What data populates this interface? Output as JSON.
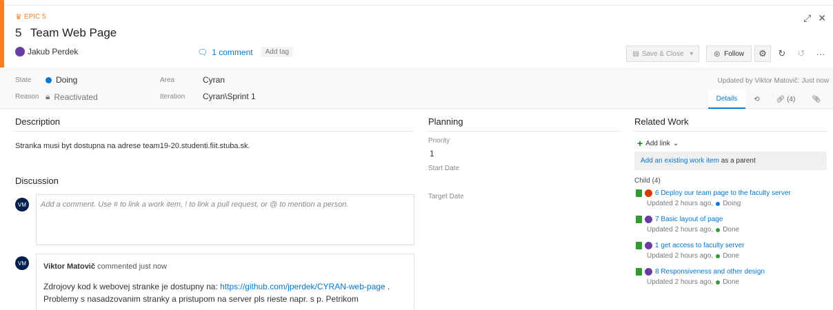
{
  "header": {
    "type_label": "EPIC 5",
    "id": "5",
    "title": "Team Web Page",
    "assignee": "Jakub Perdek",
    "comments": "1 comment",
    "add_tag": "Add tag",
    "save_label": "Save & Close",
    "follow_label": "Follow",
    "icons": [
      "crown-icon",
      "expand-icon",
      "close-icon",
      "save-icon",
      "eye-icon",
      "gear-icon",
      "refresh-icon",
      "undo-icon",
      "more-icon"
    ]
  },
  "fields": {
    "state_label": "State",
    "state_value": "Doing",
    "reason_label": "Reason",
    "reason_value": "Reactivated",
    "area_label": "Area",
    "area_value": "Cyran",
    "iteration_label": "Iteration",
    "iteration_value": "Cyran\\Sprint 1",
    "updated_by": "Updated by Viktor Matovič: Just now"
  },
  "tabs": {
    "details": "Details",
    "links": "(4)"
  },
  "description": {
    "title": "Description",
    "text": "Stranka musi byt dostupna na adrese team19-20.studenti.fiit.stuba.sk."
  },
  "discussion": {
    "title": "Discussion",
    "avatar_initials": "VM",
    "placeholder": "Add a comment. Use # to link a work item, ! to link a pull request, or @ to mention a person.",
    "comment": {
      "author": "Viktor Matovič",
      "meta": "commented just now",
      "text_prefix": "Zdrojovy kod k webovej stranke je dostupny na: ",
      "link": "https://github.com/jperdek/CYRAN-web-page",
      "text_suffix": " .",
      "text_line2": "Problemy s nasadzovanim stranky a pristupom na server pls rieste napr. s p. Petrikom"
    }
  },
  "planning": {
    "title": "Planning",
    "priority_label": "Priority",
    "priority_value": "1",
    "start_label": "Start Date",
    "target_label": "Target Date"
  },
  "related": {
    "title": "Related Work",
    "add_link": "Add link",
    "existing_link": "Add an existing work item",
    "existing_suffix": " as a parent",
    "child_header": "Child (4)",
    "children": [
      {
        "title": "6 Deploy our team page to the faculty server",
        "updated": "Updated 2 hours ago,",
        "status": "Doing",
        "status_color": "#0078d4",
        "avatar_color": "#d83b01"
      },
      {
        "title": "7 Basic layout of page",
        "updated": "Updated 2 hours ago,",
        "status": "Done",
        "status_color": "#339933",
        "avatar_color": "#6a3ea1"
      },
      {
        "title": "1 get access to faculty server",
        "updated": "Updated 2 hours ago,",
        "status": "Done",
        "status_color": "#339933",
        "avatar_color": "#6a3ea1"
      },
      {
        "title": "8 Responsiveness and other design",
        "updated": "Updated 2 hours ago,",
        "status": "Done",
        "status_color": "#339933",
        "avatar_color": "#6a3ea1"
      }
    ]
  }
}
